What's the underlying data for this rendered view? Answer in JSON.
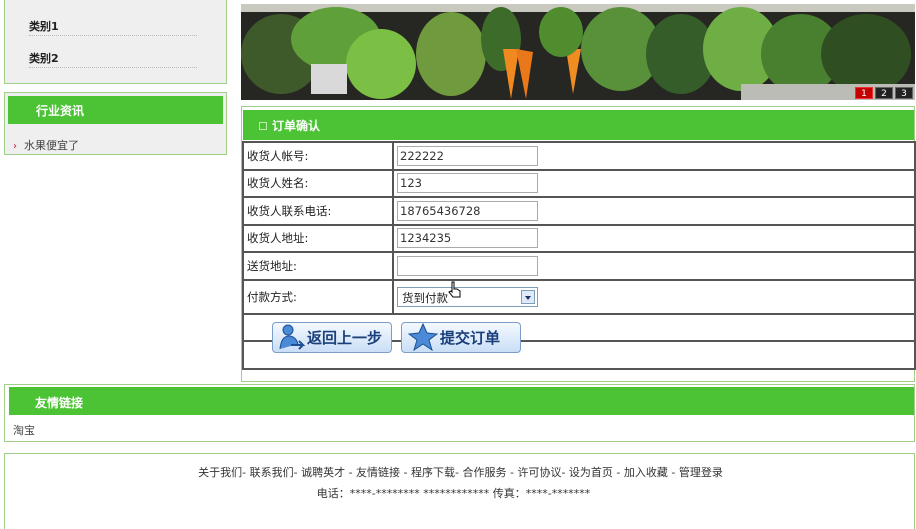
{
  "sidebar": {
    "categories": [
      "类别1",
      "类别2"
    ],
    "news_title": "行业资讯",
    "news_items": [
      "水果便宜了"
    ]
  },
  "banner": {
    "pages": [
      "1",
      "2",
      "3"
    ],
    "active_page": "1"
  },
  "order": {
    "title": "订单确认",
    "fields": [
      {
        "label": "收货人帐号:",
        "value": "222222"
      },
      {
        "label": "收货人姓名:",
        "value": "123"
      },
      {
        "label": "收货人联系电话:",
        "value": "18765436728"
      },
      {
        "label": "收货人地址:",
        "value": "1234235"
      },
      {
        "label": "送货地址:",
        "value": ""
      }
    ],
    "payment": {
      "label": "付款方式:",
      "selected": "货到付款"
    },
    "back_button": "返回上一步",
    "submit_button": "提交订单"
  },
  "links": {
    "title": "友情链接",
    "items": [
      "淘宝"
    ]
  },
  "footer": {
    "nav": "关于我们- 联系我们- 诚聘英才 - 友情链接 - 程序下载- 合作服务 - 许可协议- 设为首页 - 加入收藏 - 管理登录",
    "contact": "电话：****-******** ************ 传真：****-*******"
  },
  "colors": {
    "accent_green": "#4cc334",
    "border_green": "#9fd08a",
    "active_page_red": "#c40000"
  }
}
